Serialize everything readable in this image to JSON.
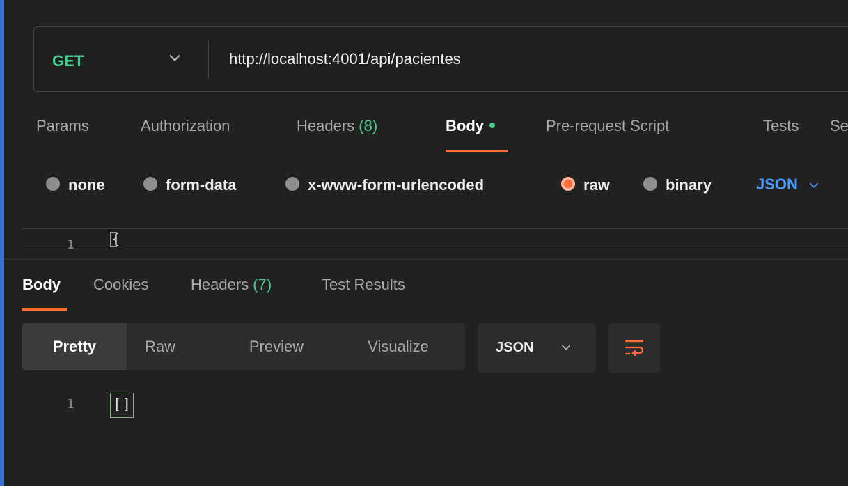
{
  "request": {
    "method": "GET",
    "url": "http://localhost:4001/api/pacientes"
  },
  "request_tabs": [
    {
      "label": "Params"
    },
    {
      "label": "Authorization"
    },
    {
      "label": "Headers",
      "count": "(8)"
    },
    {
      "label": "Body"
    },
    {
      "label": "Pre-request Script"
    },
    {
      "label": "Tests"
    },
    {
      "label": "Se"
    }
  ],
  "body_types": [
    {
      "label": "none"
    },
    {
      "label": "form-data"
    },
    {
      "label": "x-www-form-urlencoded"
    },
    {
      "label": "raw"
    },
    {
      "label": "binary"
    }
  ],
  "body_format": "JSON",
  "request_editor": {
    "line": "1",
    "code": "{"
  },
  "response_tabs": [
    {
      "label": "Body"
    },
    {
      "label": "Cookies"
    },
    {
      "label": "Headers",
      "count": "(7)"
    },
    {
      "label": "Test Results"
    }
  ],
  "response_views": [
    {
      "label": "Pretty"
    },
    {
      "label": "Raw"
    },
    {
      "label": "Preview"
    },
    {
      "label": "Visualize"
    }
  ],
  "response_format": "JSON",
  "response_editor": {
    "line": "1",
    "code": "[]"
  },
  "colors": {
    "accent": "#ff6c37",
    "method_get": "#49cc90",
    "json_link": "#4a9cff",
    "background": "#212121"
  },
  "icons": {
    "method_dropdown": "chevron-down-icon",
    "body_format_dropdown": "chevron-down-icon",
    "wrap": "text-wrap-icon"
  }
}
